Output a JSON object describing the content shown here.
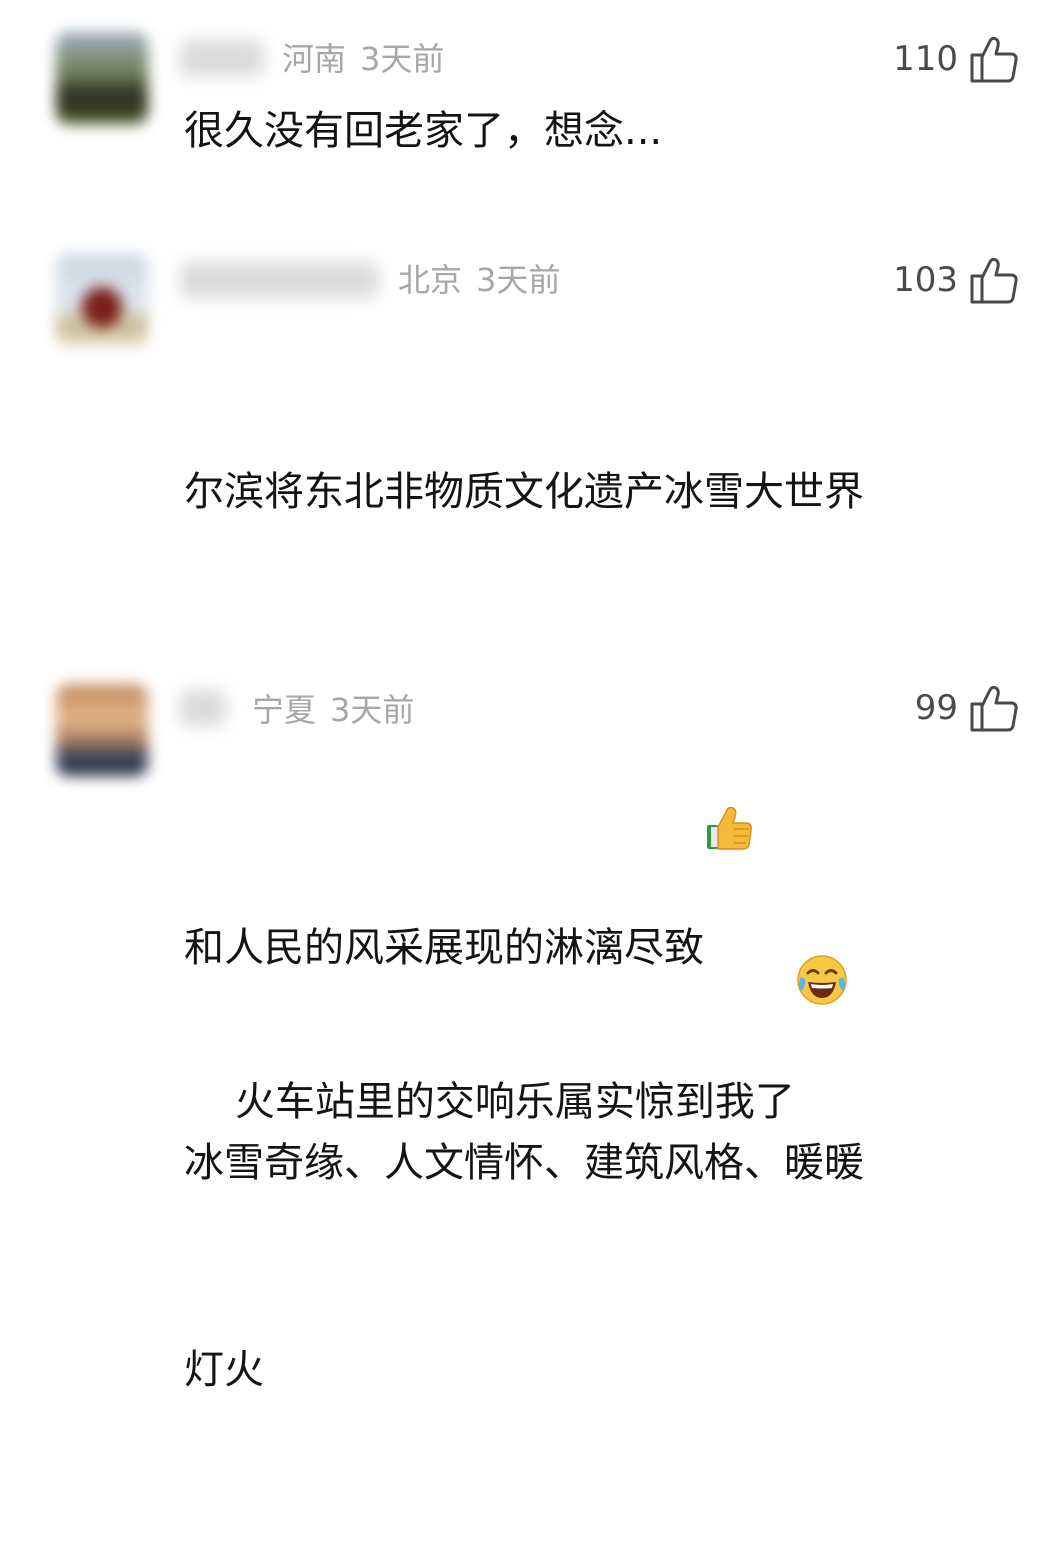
{
  "comments": [
    {
      "location": "河南",
      "time": "3天前",
      "likes": "110",
      "text": "很久没有回老家了，想念..."
    },
    {
      "location": "北京",
      "time": "3天前",
      "likes": "103",
      "text_lines": [
        "尔滨将东北非物质文化遗产冰雪大世界",
        "和人民的风采展现的淋漓尽致",
        "冰雪奇缘、人文情怀、建筑风格、暖暖",
        "灯火"
      ],
      "emoji": "thumbs-up-emoji"
    },
    {
      "location": "宁夏",
      "time": "3天前",
      "likes": "99",
      "text": "火车站里的交响乐属实惊到我了",
      "emoji": "tears-of-joy-emoji"
    }
  ],
  "icons": {
    "like": "thumb-up-outline-icon"
  },
  "colors": {
    "meta_text": "#a7a7a7",
    "body_text": "#141414",
    "like_count": "#4a4a4a"
  }
}
